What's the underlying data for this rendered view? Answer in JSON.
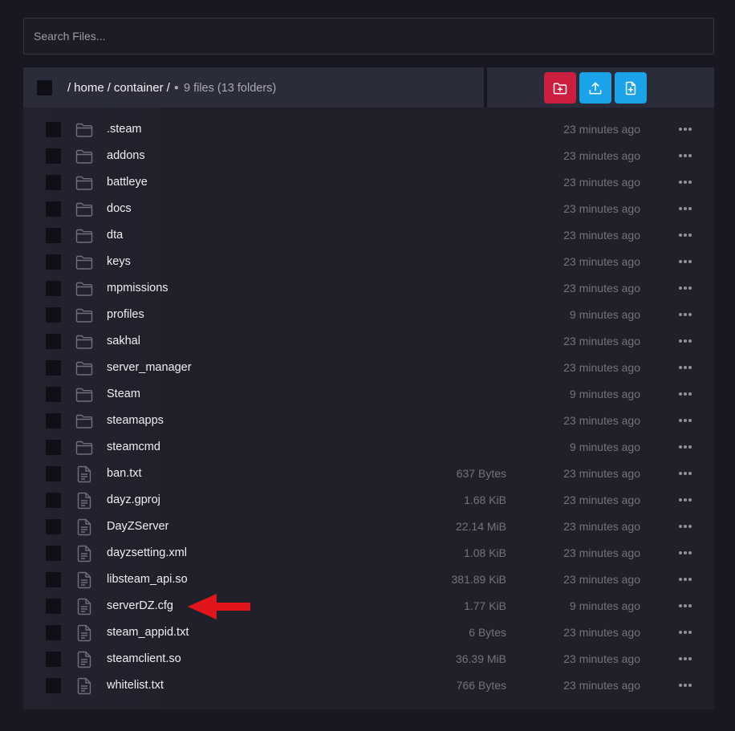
{
  "search": {
    "placeholder": "Search Files..."
  },
  "breadcrumb": {
    "path": [
      "home",
      "container"
    ],
    "summary": "9 files (13 folders)"
  },
  "actions": {
    "new_folder_icon": "folder-plus-icon",
    "upload_icon": "upload-icon",
    "new_file_icon": "file-plus-icon"
  },
  "colors": {
    "danger": "#cc1f3f",
    "primary": "#1aa3e8",
    "annotation": "#e0161c"
  },
  "files": [
    {
      "type": "folder",
      "name": ".steam",
      "size": "",
      "modified": "23 minutes ago"
    },
    {
      "type": "folder",
      "name": "addons",
      "size": "",
      "modified": "23 minutes ago"
    },
    {
      "type": "folder",
      "name": "battleye",
      "size": "",
      "modified": "23 minutes ago"
    },
    {
      "type": "folder",
      "name": "docs",
      "size": "",
      "modified": "23 minutes ago"
    },
    {
      "type": "folder",
      "name": "dta",
      "size": "",
      "modified": "23 minutes ago"
    },
    {
      "type": "folder",
      "name": "keys",
      "size": "",
      "modified": "23 minutes ago"
    },
    {
      "type": "folder",
      "name": "mpmissions",
      "size": "",
      "modified": "23 minutes ago"
    },
    {
      "type": "folder",
      "name": "profiles",
      "size": "",
      "modified": "9 minutes ago"
    },
    {
      "type": "folder",
      "name": "sakhal",
      "size": "",
      "modified": "23 minutes ago"
    },
    {
      "type": "folder",
      "name": "server_manager",
      "size": "",
      "modified": "23 minutes ago"
    },
    {
      "type": "folder",
      "name": "Steam",
      "size": "",
      "modified": "9 minutes ago"
    },
    {
      "type": "folder",
      "name": "steamapps",
      "size": "",
      "modified": "23 minutes ago"
    },
    {
      "type": "folder",
      "name": "steamcmd",
      "size": "",
      "modified": "9 minutes ago"
    },
    {
      "type": "file",
      "name": "ban.txt",
      "size": "637 Bytes",
      "modified": "23 minutes ago"
    },
    {
      "type": "file",
      "name": "dayz.gproj",
      "size": "1.68 KiB",
      "modified": "23 minutes ago"
    },
    {
      "type": "file",
      "name": "DayZServer",
      "size": "22.14 MiB",
      "modified": "23 minutes ago"
    },
    {
      "type": "file",
      "name": "dayzsetting.xml",
      "size": "1.08 KiB",
      "modified": "23 minutes ago"
    },
    {
      "type": "file",
      "name": "libsteam_api.so",
      "size": "381.89 KiB",
      "modified": "23 minutes ago"
    },
    {
      "type": "file",
      "name": "serverDZ.cfg",
      "size": "1.77 KiB",
      "modified": "9 minutes ago",
      "highlighted": true
    },
    {
      "type": "file",
      "name": "steam_appid.txt",
      "size": "6 Bytes",
      "modified": "23 minutes ago"
    },
    {
      "type": "file",
      "name": "steamclient.so",
      "size": "36.39 MiB",
      "modified": "23 minutes ago"
    },
    {
      "type": "file",
      "name": "whitelist.txt",
      "size": "766 Bytes",
      "modified": "23 minutes ago"
    }
  ]
}
